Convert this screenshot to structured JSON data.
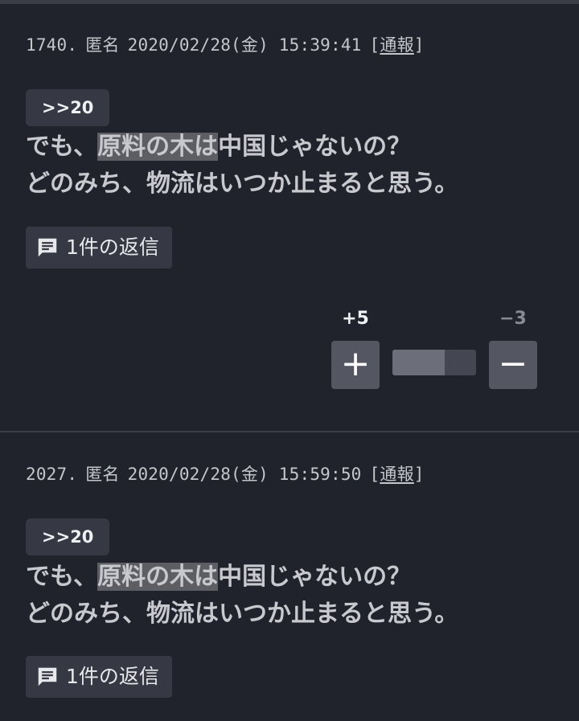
{
  "comments": [
    {
      "number": "1740.",
      "author": "匿名",
      "datetime": "2020/02/28(金) 15:39:41",
      "report_open": "[",
      "report_label": "通報",
      "report_close": "]",
      "anchor": ">>20",
      "body_line1_pre": "でも、",
      "body_line1_hl": "原料の木は",
      "body_line1_post": "中国じゃないの？",
      "body_line2": "どのみち、物流はいつか止まると思う。",
      "reply_label": "1件の返信",
      "vote": {
        "plus_label": "+5",
        "minus_label": "−3",
        "plus_button": "+",
        "minus_button": "−",
        "ratio": 0.625
      }
    },
    {
      "number": "2027.",
      "author": "匿名",
      "datetime": "2020/02/28(金) 15:59:50",
      "report_open": "[",
      "report_label": "通報",
      "report_close": "]",
      "anchor": ">>20",
      "body_line1_pre": "でも、",
      "body_line1_hl": "原料の木は",
      "body_line1_post": "中国じゃないの？",
      "body_line2": "どのみち、物流はいつか止まると思う。",
      "reply_label": "1件の返信"
    }
  ],
  "icons": {
    "reply": "comment-icon"
  },
  "colors": {
    "background": "#20232b",
    "button": "#363943",
    "vote_button": "#545762",
    "highlight": "#5c5e63"
  }
}
